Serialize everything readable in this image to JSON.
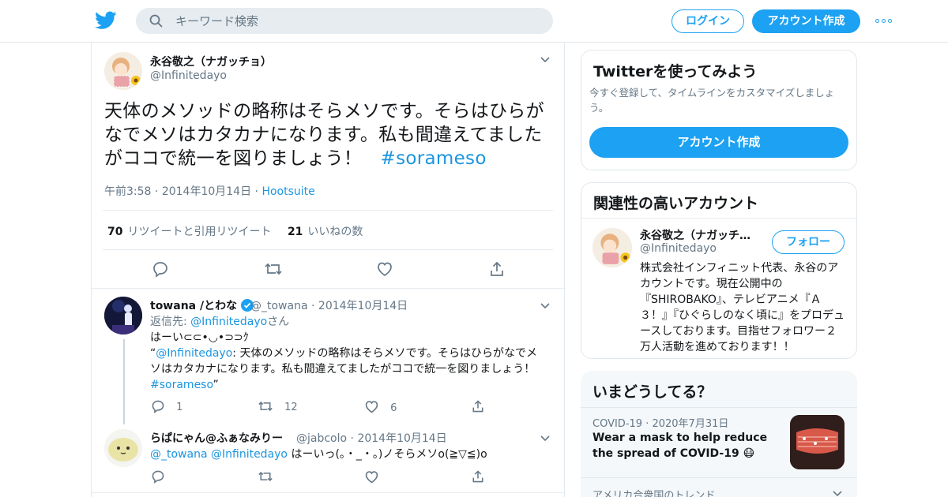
{
  "topbar": {
    "search_placeholder": "キーワード検索",
    "login_label": "ログイン",
    "signup_label": "アカウント作成"
  },
  "tweet": {
    "author_name": "永谷敬之（ナガッチョ）",
    "author_handle": "@Infinitedayo",
    "text_main": "天体のメソッドの略称はそらメソです。そらはひらがなでメソはカタカナになります。私も間違えてましたがココで統一を図りましょう！　",
    "hashtag": "#sorameso",
    "time": "午前3:58",
    "date": "2014年10月14日",
    "source": "Hootsuite",
    "retweet_count": "70",
    "retweet_label": "リツイートと引用リツイート",
    "like_count": "21",
    "like_label": "いいねの数"
  },
  "replies": [
    {
      "name": "towana /とわな",
      "handle": "@_towana",
      "date": "2014年10月14日",
      "reply_to_prefix": "返信先: ",
      "reply_to_handle": "@Infinitedayo",
      "reply_to_suffix": "さん",
      "line1": "はーい⊂⊂•◡•⊃⊃ｸ",
      "quote_open": "“",
      "quote_handle": "@Infinitedayo",
      "quote_text": ": 天体のメソッドの略称はそらメソです。そらはひらがなでメソはカタカナになります。私も間違えてましたがココで統一を図りましょう！　",
      "quote_hashtag": "#sorameso",
      "quote_close": "”",
      "reply_count": "1",
      "retweet_count": "12",
      "like_count": "6"
    },
    {
      "name": "らぱにゃん@ふぁなみりー",
      "handle": "@jabcolo",
      "date": "2014年10月14日",
      "mention1": "@_towana",
      "mention2": "@Infinitedayo",
      "text": " はーいっ(。・_・。)ノそらメソo(≧▽≦)o"
    }
  ],
  "sidebar": {
    "try_title": "Twitterを使ってみよう",
    "try_desc": "今すぐ登録して、タイムラインをカスタマイズしましょう。",
    "try_button": "アカウント作成",
    "related_title": "関連性の高いアカウント",
    "related_name": "永谷敬之（ナガッチ…",
    "related_handle": "@Infinitedayo",
    "follow_label": "フォロー",
    "related_bio": "株式会社インフィニット代表、永谷のアカウントです。現在公開中の『SHIROBAKO』、テレビアニメ『Ａ３！』『ひぐらしのなく頃に』をプロデュースしております。目指せフォロワー２万人活動を進めております！！",
    "trends_title": "いまどうしてる？",
    "trend_category": "COVID-19",
    "trend_date": "2020年7月31日",
    "trend_headline": "Wear a mask to help reduce the spread of COVID-19 😷",
    "trends_location": "アメリカ合衆国のトレンド"
  },
  "colors": {
    "brand_blue": "#1da1f2",
    "link_blue": "#1b95e0",
    "muted": "#657786",
    "border": "#e1e8ed"
  },
  "icons": [
    "twitter-bird-icon",
    "search-icon",
    "more-icon",
    "chevron-down-icon",
    "reply-icon",
    "retweet-icon",
    "like-icon",
    "share-icon",
    "verified-badge-icon"
  ]
}
